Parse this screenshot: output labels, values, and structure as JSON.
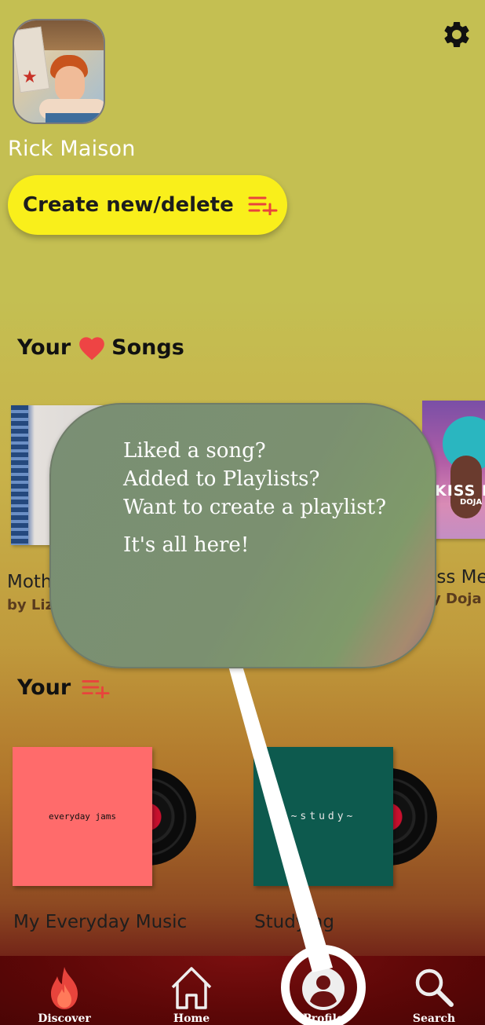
{
  "profile": {
    "username": "Rick Maison",
    "settings_icon": "gear-icon"
  },
  "create_button": {
    "label": "Create new/delete",
    "icon": "playlist-add-icon"
  },
  "liked_section": {
    "title_prefix": "Your",
    "title_suffix": "Songs",
    "heart_icon": "heart-icon",
    "heart_color": "#ee4444",
    "songs": [
      {
        "title": "Moth",
        "artist": "by Liz"
      },
      {
        "title": "iss Me",
        "artist": "y Doja",
        "art_text": "KISS M",
        "art_subtext": "DOJA C"
      }
    ]
  },
  "playlists_section": {
    "title_prefix": "Your",
    "icon": "playlist-add-icon",
    "playlists": [
      {
        "name": "My Everyday Music",
        "cover_text": "everyday jams",
        "cover_color": "#ff6b6b"
      },
      {
        "name": "Studying",
        "cover_text": "~study~",
        "cover_color": "#0d5a4e"
      }
    ]
  },
  "tooltip": {
    "lines": [
      "Liked a song?",
      "Added to Playlists?",
      "Want to create a playlist?"
    ],
    "footer": "It's all here!"
  },
  "bottom_nav": {
    "items": [
      {
        "label": "Discover",
        "icon": "flame-icon"
      },
      {
        "label": "Home",
        "icon": "home-icon"
      },
      {
        "label": "Profile",
        "icon": "user-icon",
        "active": true
      },
      {
        "label": "Search",
        "icon": "search-icon"
      }
    ]
  },
  "colors": {
    "accent_yellow": "#f9ef1b",
    "accent_red": "#e8443c",
    "nav_background": "#5c0707"
  }
}
